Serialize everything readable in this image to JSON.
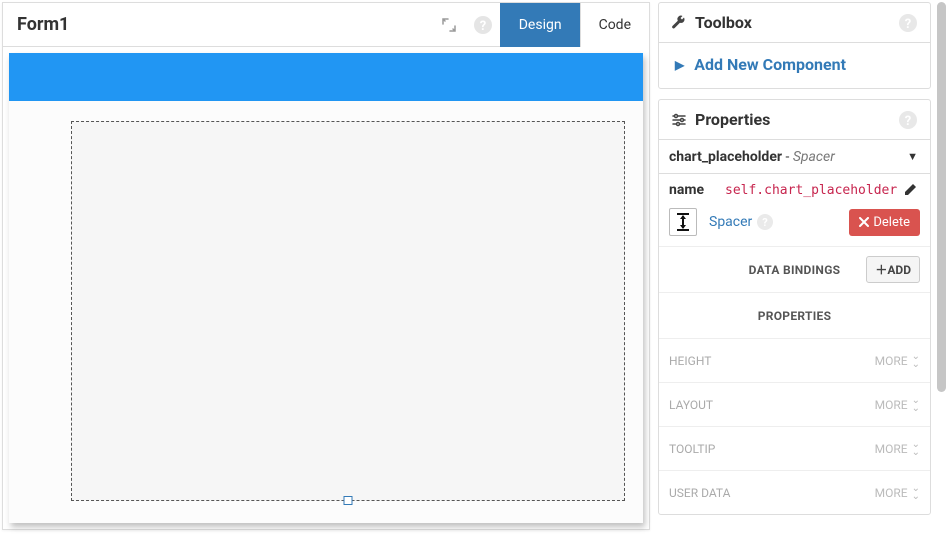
{
  "header": {
    "title": "Form1",
    "tabs": {
      "design": "Design",
      "code": "Code"
    }
  },
  "toolbox": {
    "title": "Toolbox",
    "add_new": "Add New Component"
  },
  "properties": {
    "title": "Properties",
    "selected_name": "chart_placeholder",
    "selected_type": "Spacer",
    "name_label": "name",
    "name_value": "self.chart_placeholder",
    "type_link": "Spacer",
    "delete_label": "Delete",
    "sections": {
      "data_bindings": "DATA BINDINGS",
      "add": "ADD",
      "properties": "PROPERTIES"
    },
    "rows": {
      "height": "HEIGHT",
      "layout": "LAYOUT",
      "tooltip": "TOOLTIP",
      "user_data": "USER DATA"
    },
    "more": "MORE"
  }
}
